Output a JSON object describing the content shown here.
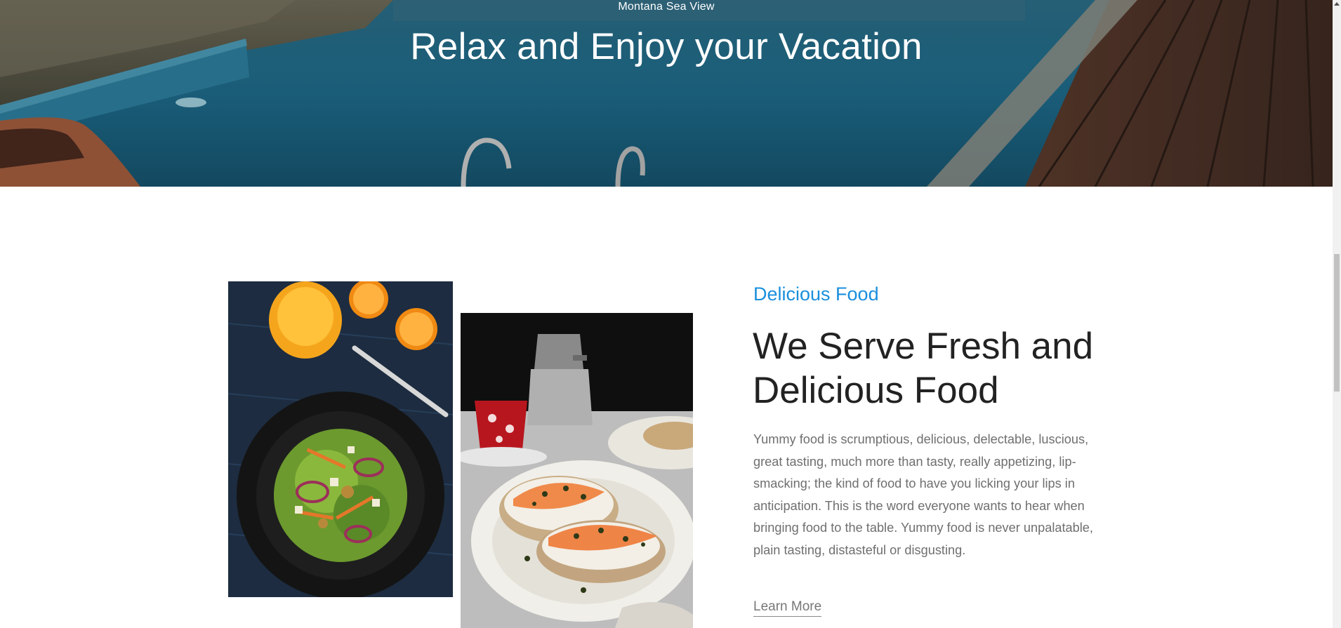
{
  "hero": {
    "subtitle": "Montana Sea View",
    "title": "Relax and Enjoy your Vacation"
  },
  "food": {
    "eyebrow": "Delicious Food",
    "heading": "We Serve Fresh and Delicious Food",
    "body": "Yummy food is scrumptious, delicious, delectable, luscious, great tasting, much more than tasty, really appetizing, lip-smacking; the kind of food to have you licking your lips in anticipation. This is the word everyone wants to hear when bringing food to the table. Yummy food is never unpalatable, plain tasting, distasteful or disgusting.",
    "cta_label": "Learn More",
    "images": [
      "salad-photo",
      "salmon-toast-photo"
    ]
  },
  "colors": {
    "accent": "#1a8fdc",
    "heading": "#222222",
    "body_text": "#6f6f6f"
  }
}
